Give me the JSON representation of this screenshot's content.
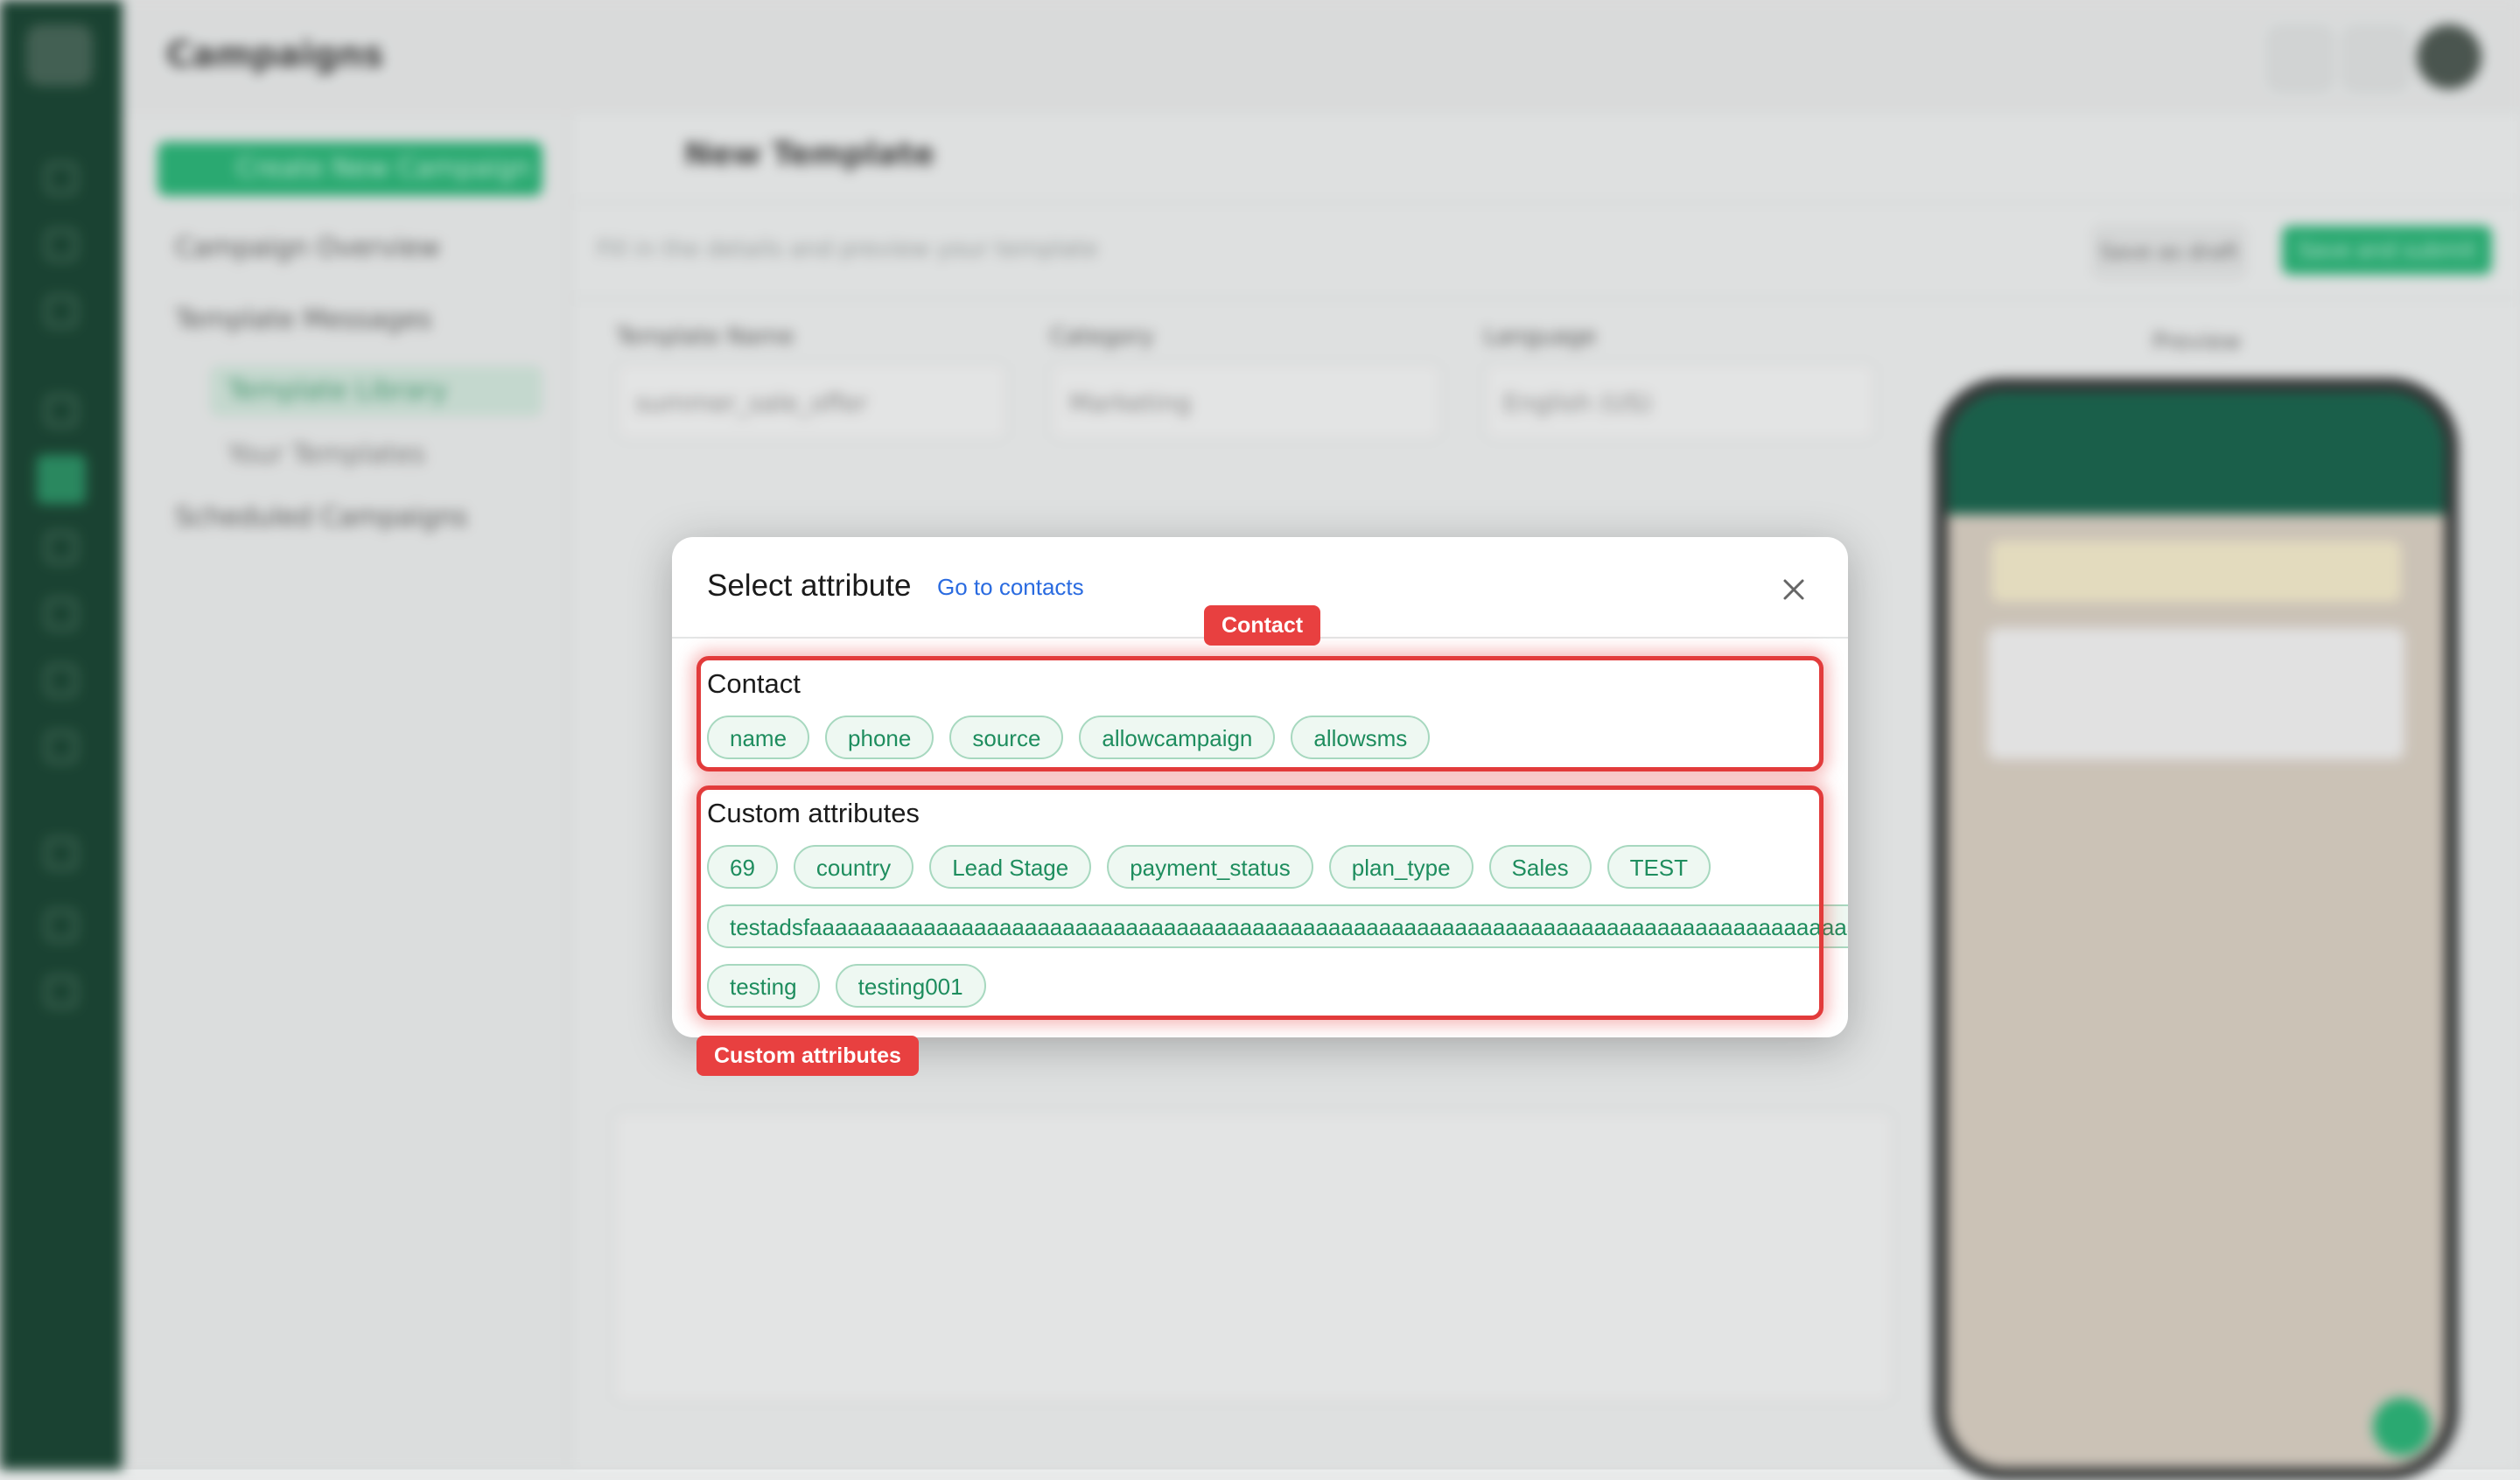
{
  "app": {
    "page_title": "Campaigns"
  },
  "sidebar": {
    "create_button": "Create New Campaign",
    "items": [
      {
        "label": "Campaign Overview"
      },
      {
        "label": "Template Messages"
      },
      {
        "label": "Template Library"
      },
      {
        "label": "Your Templates"
      },
      {
        "label": "Scheduled Campaigns"
      }
    ]
  },
  "editor_page": {
    "title": "New Template",
    "subtitle": "Fill in the details and preview your template",
    "save_draft": "Save as draft",
    "save_submit": "Save and submit",
    "template_name_label": "Template Name",
    "template_name_value": "summer_sale_offer",
    "category_label": "Category",
    "category_value": "Marketing",
    "language_label": "Language",
    "language_value": "English (US)",
    "preview_label": "Preview"
  },
  "modal": {
    "title": "Select attribute",
    "link": "Go to contacts",
    "sections": {
      "contact": {
        "title": "Contact",
        "chips": [
          "name",
          "phone",
          "source",
          "allowcampaign",
          "allowsms"
        ]
      },
      "custom": {
        "title": "Custom attributes",
        "row1": [
          "69",
          "country",
          "Lead Stage",
          "payment_status",
          "plan_type",
          "Sales",
          "TEST"
        ],
        "row2": [
          "testadsfaaaaaaaaaaaaaaaaaaaaaaaaaaaaaaaaaaaaaaaaaaaaaaaaaaaaaaaaaaaaaaaaaaaaaaaaaaaaaaaaaaaa"
        ],
        "row3": [
          "testing",
          "testing001"
        ]
      }
    }
  },
  "annotations": {
    "contact_label": "Contact",
    "custom_label": "Custom attributes",
    "color": "#e23b3b"
  },
  "colors": {
    "brand_green": "#1fb070",
    "chip_text": "#1e8d5e",
    "link_blue": "#2a6be0"
  },
  "icons": {
    "close": "close-icon"
  }
}
